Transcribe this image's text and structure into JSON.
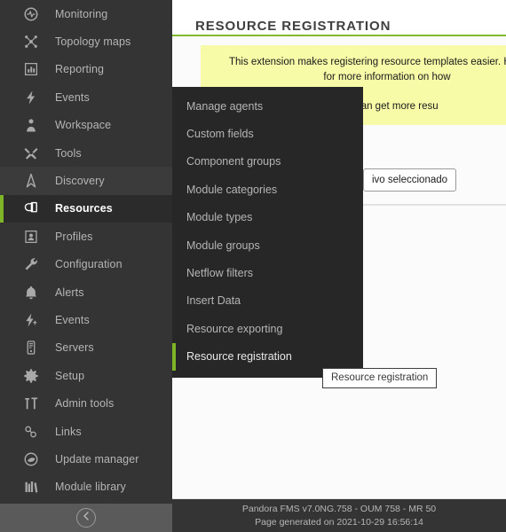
{
  "sidebar": {
    "items": [
      {
        "label": "Monitoring",
        "icon": "pulse-icon",
        "state": "normal"
      },
      {
        "label": "Topology maps",
        "icon": "topology-icon",
        "state": "normal"
      },
      {
        "label": "Reporting",
        "icon": "chart-box-icon",
        "state": "normal"
      },
      {
        "label": "Events",
        "icon": "bolt-icon",
        "state": "normal"
      },
      {
        "label": "Workspace",
        "icon": "person-icon",
        "state": "normal"
      },
      {
        "label": "Tools",
        "icon": "tools-icon",
        "state": "normal"
      },
      {
        "label": "Discovery",
        "icon": "compass-icon",
        "state": "hover"
      },
      {
        "label": "Resources",
        "icon": "resources-icon",
        "state": "active"
      },
      {
        "label": "Profiles",
        "icon": "id-card-icon",
        "state": "normal"
      },
      {
        "label": "Configuration",
        "icon": "wrench-icon",
        "state": "normal"
      },
      {
        "label": "Alerts",
        "icon": "bell-icon",
        "state": "normal"
      },
      {
        "label": "Events",
        "icon": "bolt-plus-icon",
        "state": "normal"
      },
      {
        "label": "Servers",
        "icon": "server-icon",
        "state": "normal"
      },
      {
        "label": "Setup",
        "icon": "gear-icon",
        "state": "normal"
      },
      {
        "label": "Admin tools",
        "icon": "hammer-icon",
        "state": "normal"
      },
      {
        "label": "Links",
        "icon": "link-icon",
        "state": "normal"
      },
      {
        "label": "Update manager",
        "icon": "update-icon",
        "state": "normal"
      },
      {
        "label": "Module library",
        "icon": "library-icon",
        "state": "normal"
      }
    ],
    "collapse_icon": "chevron-left-icon"
  },
  "submenu": {
    "items": [
      {
        "label": "Manage agents",
        "selected": false
      },
      {
        "label": "Custom fields",
        "selected": false
      },
      {
        "label": "Component groups",
        "selected": false
      },
      {
        "label": "Module categories",
        "selected": false
      },
      {
        "label": "Module types",
        "selected": false
      },
      {
        "label": "Module groups",
        "selected": false
      },
      {
        "label": "Netflow filters",
        "selected": false
      },
      {
        "label": "Insert Data",
        "selected": false
      },
      {
        "label": "Resource exporting",
        "selected": false
      },
      {
        "label": "Resource registration",
        "selected": true
      }
    ]
  },
  "header": {
    "title": "RESOURCE REGISTRATION"
  },
  "notice": {
    "line1": "This extension makes registering resource templates easier. Here you",
    "line2": "for more information on how",
    "line3": "You can get more resu"
  },
  "form": {
    "file_input_value": "ivo seleccionado"
  },
  "tooltip": {
    "text": "Resource registration"
  },
  "footer": {
    "line1": "Pandora FMS v7.0NG.758 - OUM 758 - MR 50",
    "line2": "Page generated on 2021-10-29 16:56:14"
  },
  "colors": {
    "accent_green": "#82b92e",
    "sidebar_bg": "#343434",
    "submenu_bg": "#272727",
    "notice_bg": "#f7fba7"
  }
}
